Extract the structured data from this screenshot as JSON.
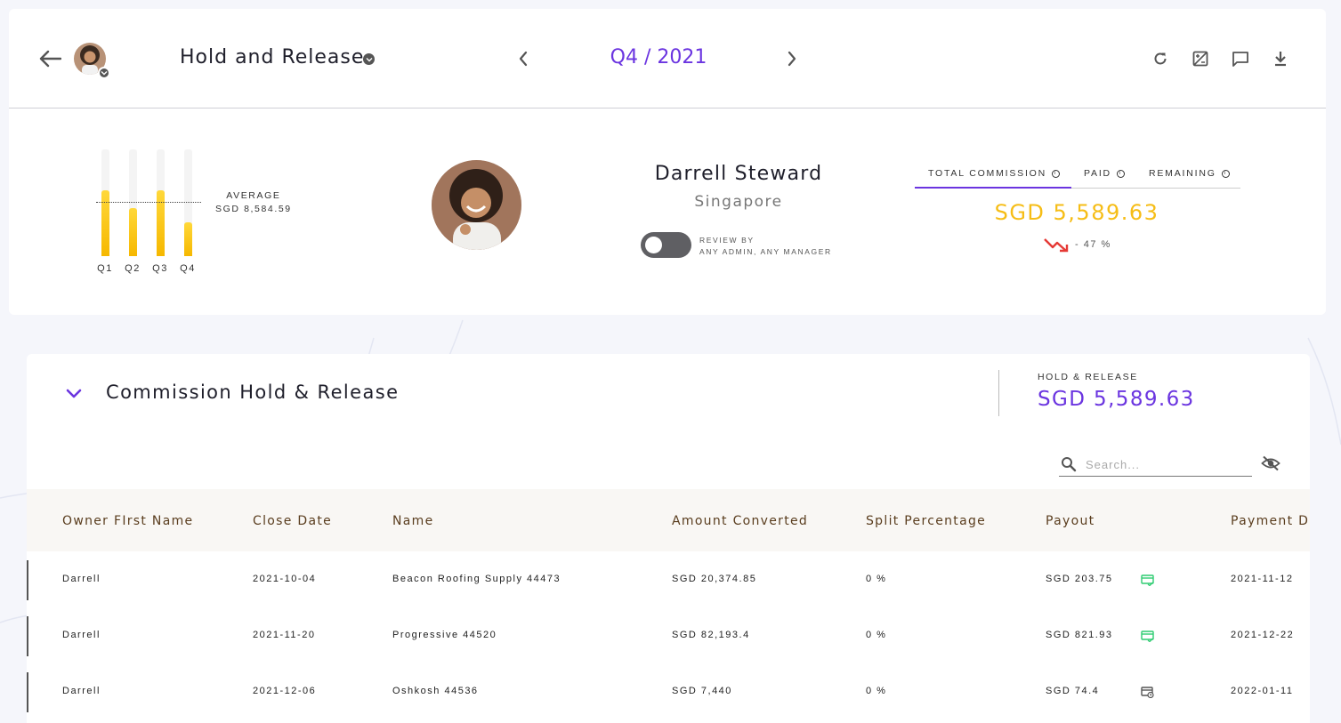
{
  "header": {
    "title": "Hold and Release",
    "period": "Q4 / 2021"
  },
  "quarters": {
    "values": [
      {
        "label": "Q1",
        "level": 0.62
      },
      {
        "label": "Q2",
        "level": 0.45
      },
      {
        "label": "Q3",
        "level": 0.62
      },
      {
        "label": "Q4",
        "level": 0.32
      }
    ],
    "average_label": "AVERAGE",
    "average_value": "SGD 8,584.59"
  },
  "user": {
    "name": "Darrell Steward",
    "location": "Singapore",
    "review_title": "REVIEW BY",
    "review_value": "ANY ADMIN, ANY MANAGER"
  },
  "commission_tabs": {
    "items": [
      {
        "label": "TOTAL COMMISSION"
      },
      {
        "label": "PAID"
      },
      {
        "label": "REMAINING"
      }
    ],
    "value": "SGD 5,589.63",
    "trend": "- 47 %"
  },
  "section": {
    "title": "Commission Hold & Release",
    "summary_label": "HOLD & RELEASE",
    "summary_value": "SGD 5,589.63",
    "search_placeholder": "Search..."
  },
  "table": {
    "columns": [
      "Owner FIrst Name",
      "Close Date",
      "Name",
      "Amount Converted",
      "Split Percentage",
      "Payout",
      "Payment Date"
    ],
    "rows": [
      {
        "owner": "Darrell",
        "close_date": "2021-10-04",
        "name": "Beacon Roofing Supply 44473",
        "amount": "SGD 20,374.85",
        "split": "0 %",
        "payout": "SGD 203.75",
        "payout_icon": "card-check-icon",
        "payment_date": "2021-11-12"
      },
      {
        "owner": "Darrell",
        "close_date": "2021-11-20",
        "name": "Progressive 44520",
        "amount": "SGD 82,193.4",
        "split": "0 %",
        "payout": "SGD 821.93",
        "payout_icon": "card-check-icon",
        "payment_date": "2021-12-22"
      },
      {
        "owner": "Darrell",
        "close_date": "2021-12-06",
        "name": "Oshkosh 44536",
        "amount": "SGD 7,440",
        "split": "0 %",
        "payout": "SGD 74.4",
        "payout_icon": "card-clock-icon",
        "payment_date": "2022-01-11"
      }
    ]
  },
  "colors": {
    "accent": "#6b35e0",
    "commission": "#f6bd16",
    "bar": "#f6b800",
    "paid_icon": "#2ecc71",
    "trend_down": "#e53935"
  }
}
